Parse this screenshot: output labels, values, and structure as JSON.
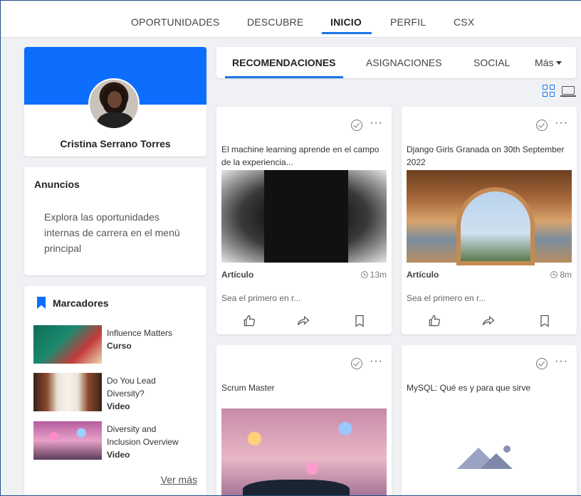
{
  "topnav": {
    "items": [
      "OPORTUNIDADES",
      "DESCUBRE",
      "INICIO",
      "PERFIL",
      "CSX"
    ],
    "active": "INICIO"
  },
  "profile": {
    "name": "Cristina Serrano Torres"
  },
  "anuncios": {
    "title": "Anuncios",
    "text": "Explora las oportunidades internas de carrera en el menú principal"
  },
  "marcadores": {
    "title": "Marcadores",
    "items": [
      {
        "title": "Influence Matters",
        "type": "Curso"
      },
      {
        "title": "Do You Lead Diversity?",
        "type": "Video"
      },
      {
        "title": "Diversity and Inclusion Overview",
        "type": "Video"
      }
    ],
    "more": "Ver más"
  },
  "tabs": {
    "items": [
      "RECOMENDACIONES",
      "ASIGNACIONES",
      "SOCIAL",
      "Más"
    ],
    "active": "RECOMENDACIONES"
  },
  "feed": [
    {
      "title": "El machine learning aprende en el campo de la experiencia...",
      "kind": "Artículo",
      "time": "13m",
      "comment": "Sea el primero en r..."
    },
    {
      "title": "Django Girls Granada on 30th September 2022",
      "kind": "Artículo",
      "time": "8m",
      "comment": "Sea el primero en r..."
    },
    {
      "title": "Scrum Master"
    },
    {
      "title": "MySQL: Qué es y para que sirve"
    }
  ],
  "colors": {
    "accent": "#1a73e8",
    "banner": "#0d6efd",
    "background": "#eff1f4"
  },
  "icons": [
    "grid-view-icon",
    "list-view-icon",
    "check-circle-icon",
    "more-dots-icon",
    "clock-icon",
    "like-icon",
    "share-icon",
    "bookmark-icon"
  ]
}
